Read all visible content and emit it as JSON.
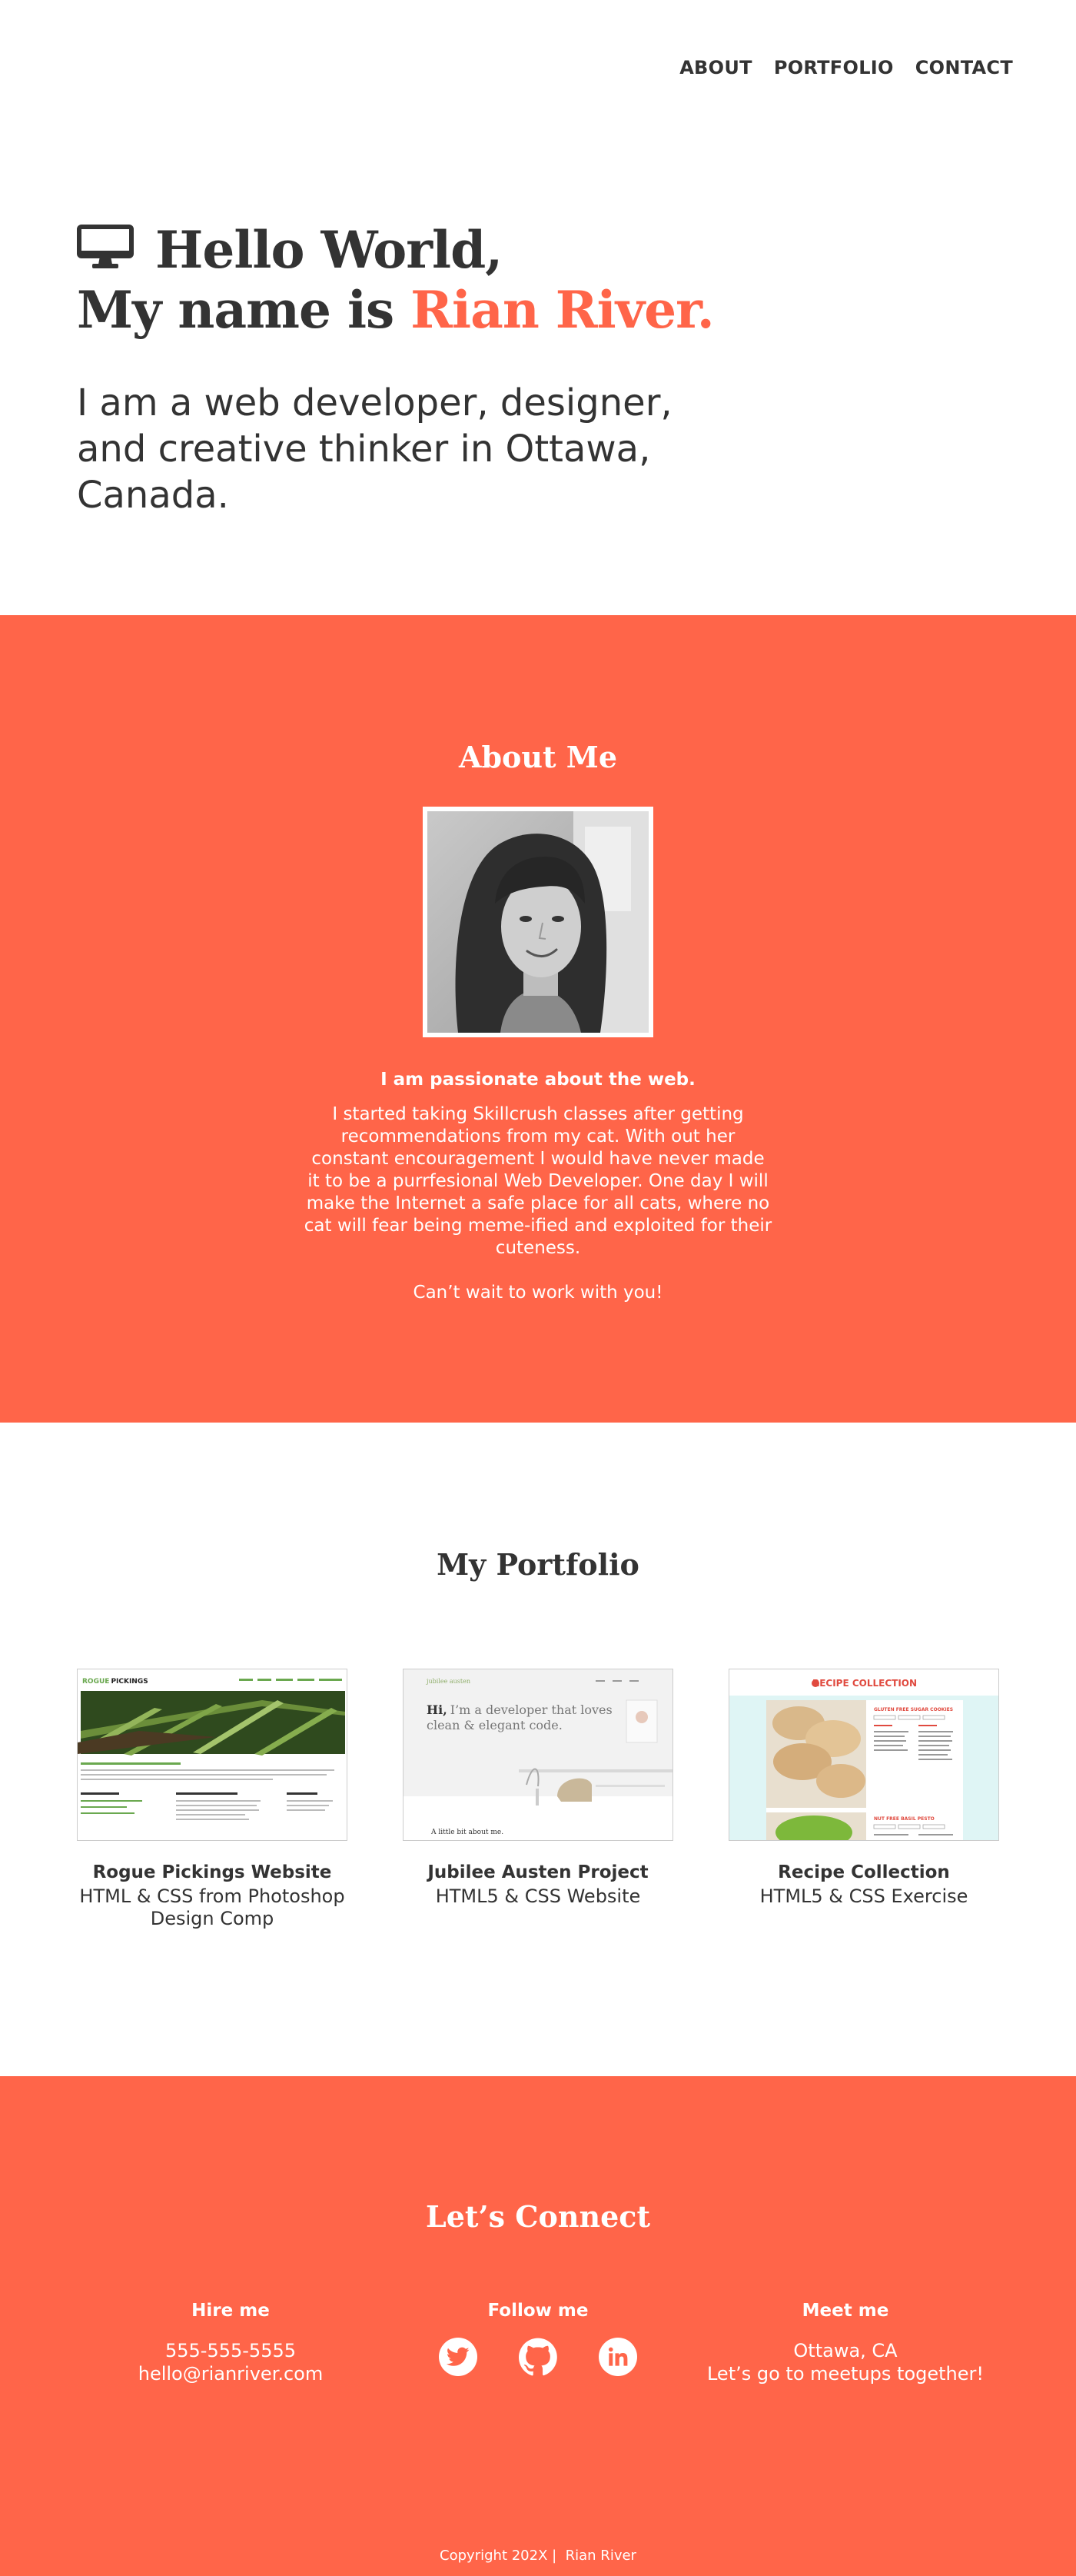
{
  "nav": {
    "items": [
      "ABOUT",
      "PORTFOLIO",
      "CONTACT"
    ]
  },
  "hero": {
    "icon": "desktop-monitor-icon",
    "line1": "Hello World,",
    "line2_prefix": "My name is ",
    "line2_name": "Rian River.",
    "subtitle": "I am a web developer, designer, and creative thinker in Ottawa, Canada."
  },
  "about": {
    "title": "About Me",
    "heading": "I am passionate about the web.",
    "body": "I started taking Skillcrush classes after getting recommendations from my cat. With out her constant encouragement I would have never made it to be a purrfesional Web Developer. One day I will make the Internet a safe place for all cats, where no cat will fear being meme-ified and exploited for their cuteness.",
    "cta": "Can’t wait to work with you!"
  },
  "portfolio": {
    "title": "My Portfolio",
    "items": [
      {
        "title": "Rogue Pickings Website",
        "subtitle": "HTML & CSS from Photoshop Design Comp",
        "thumb": {
          "brand_a": "ROGUE",
          "brand_b": "PICKINGS"
        }
      },
      {
        "title": "Jubilee Austen Project",
        "subtitle": "HTML5 & CSS Website",
        "thumb": {
          "brand": "jubilee austen",
          "hi": "Hi,",
          "tagline_1": "I’m a developer that loves",
          "tagline_2": "clean & elegant code.",
          "footer": "A little bit about me."
        }
      },
      {
        "title": "Recipe Collection",
        "subtitle": "HTML5 & CSS Exercise",
        "thumb": {
          "brand": "RECIPE COLLECTION",
          "card_1": "GLUTEN FREE SUGAR COOKIES",
          "card_2": "NUT FREE BASIL PESTO"
        }
      }
    ]
  },
  "connect": {
    "title": "Let’s Connect",
    "hire": {
      "heading": "Hire me",
      "phone": "555-555-5555",
      "email": "hello@rianriver.com"
    },
    "follow": {
      "heading": "Follow me",
      "icons": [
        "twitter-icon",
        "github-icon",
        "linkedin-icon"
      ]
    },
    "meet": {
      "heading": "Meet me",
      "location": "Ottawa, CA",
      "note": "Let’s go to meetups together!"
    },
    "copyright": "Copyright 202X |  Rian River"
  },
  "colors": {
    "accent": "#ff6549",
    "text": "#333333",
    "white": "#ffffff"
  }
}
